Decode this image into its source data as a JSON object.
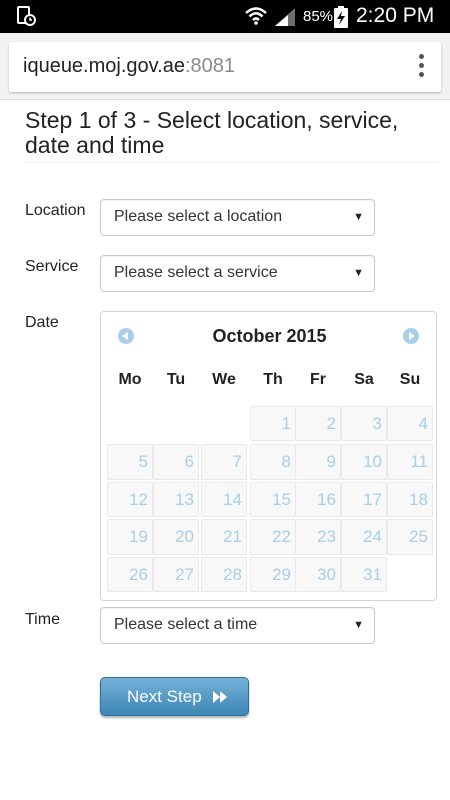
{
  "status_bar": {
    "battery_percent": "85%",
    "time": "2:20 PM"
  },
  "browser": {
    "url_host": "iqueue.moj.gov.ae",
    "url_port": ":8081"
  },
  "page": {
    "title": "Step 1 of 3 - Select location, service, date and time"
  },
  "form": {
    "location_label": "Location",
    "location_value": "Please select a location",
    "service_label": "Service",
    "service_value": "Please select a service",
    "date_label": "Date",
    "time_label": "Time",
    "time_value": "Please select a time"
  },
  "calendar": {
    "month_label": "October 2015",
    "weekdays": [
      "Mo",
      "Tu",
      "We",
      "Th",
      "Fr",
      "Sa",
      "Su"
    ],
    "first_weekday_index": 3,
    "days_in_month": 31,
    "day_color": "#a7cfe6"
  },
  "buttons": {
    "next_step_label": "Next Step"
  },
  "colors": {
    "button_top": "#75b1d8",
    "button_bottom": "#3d86b6"
  }
}
